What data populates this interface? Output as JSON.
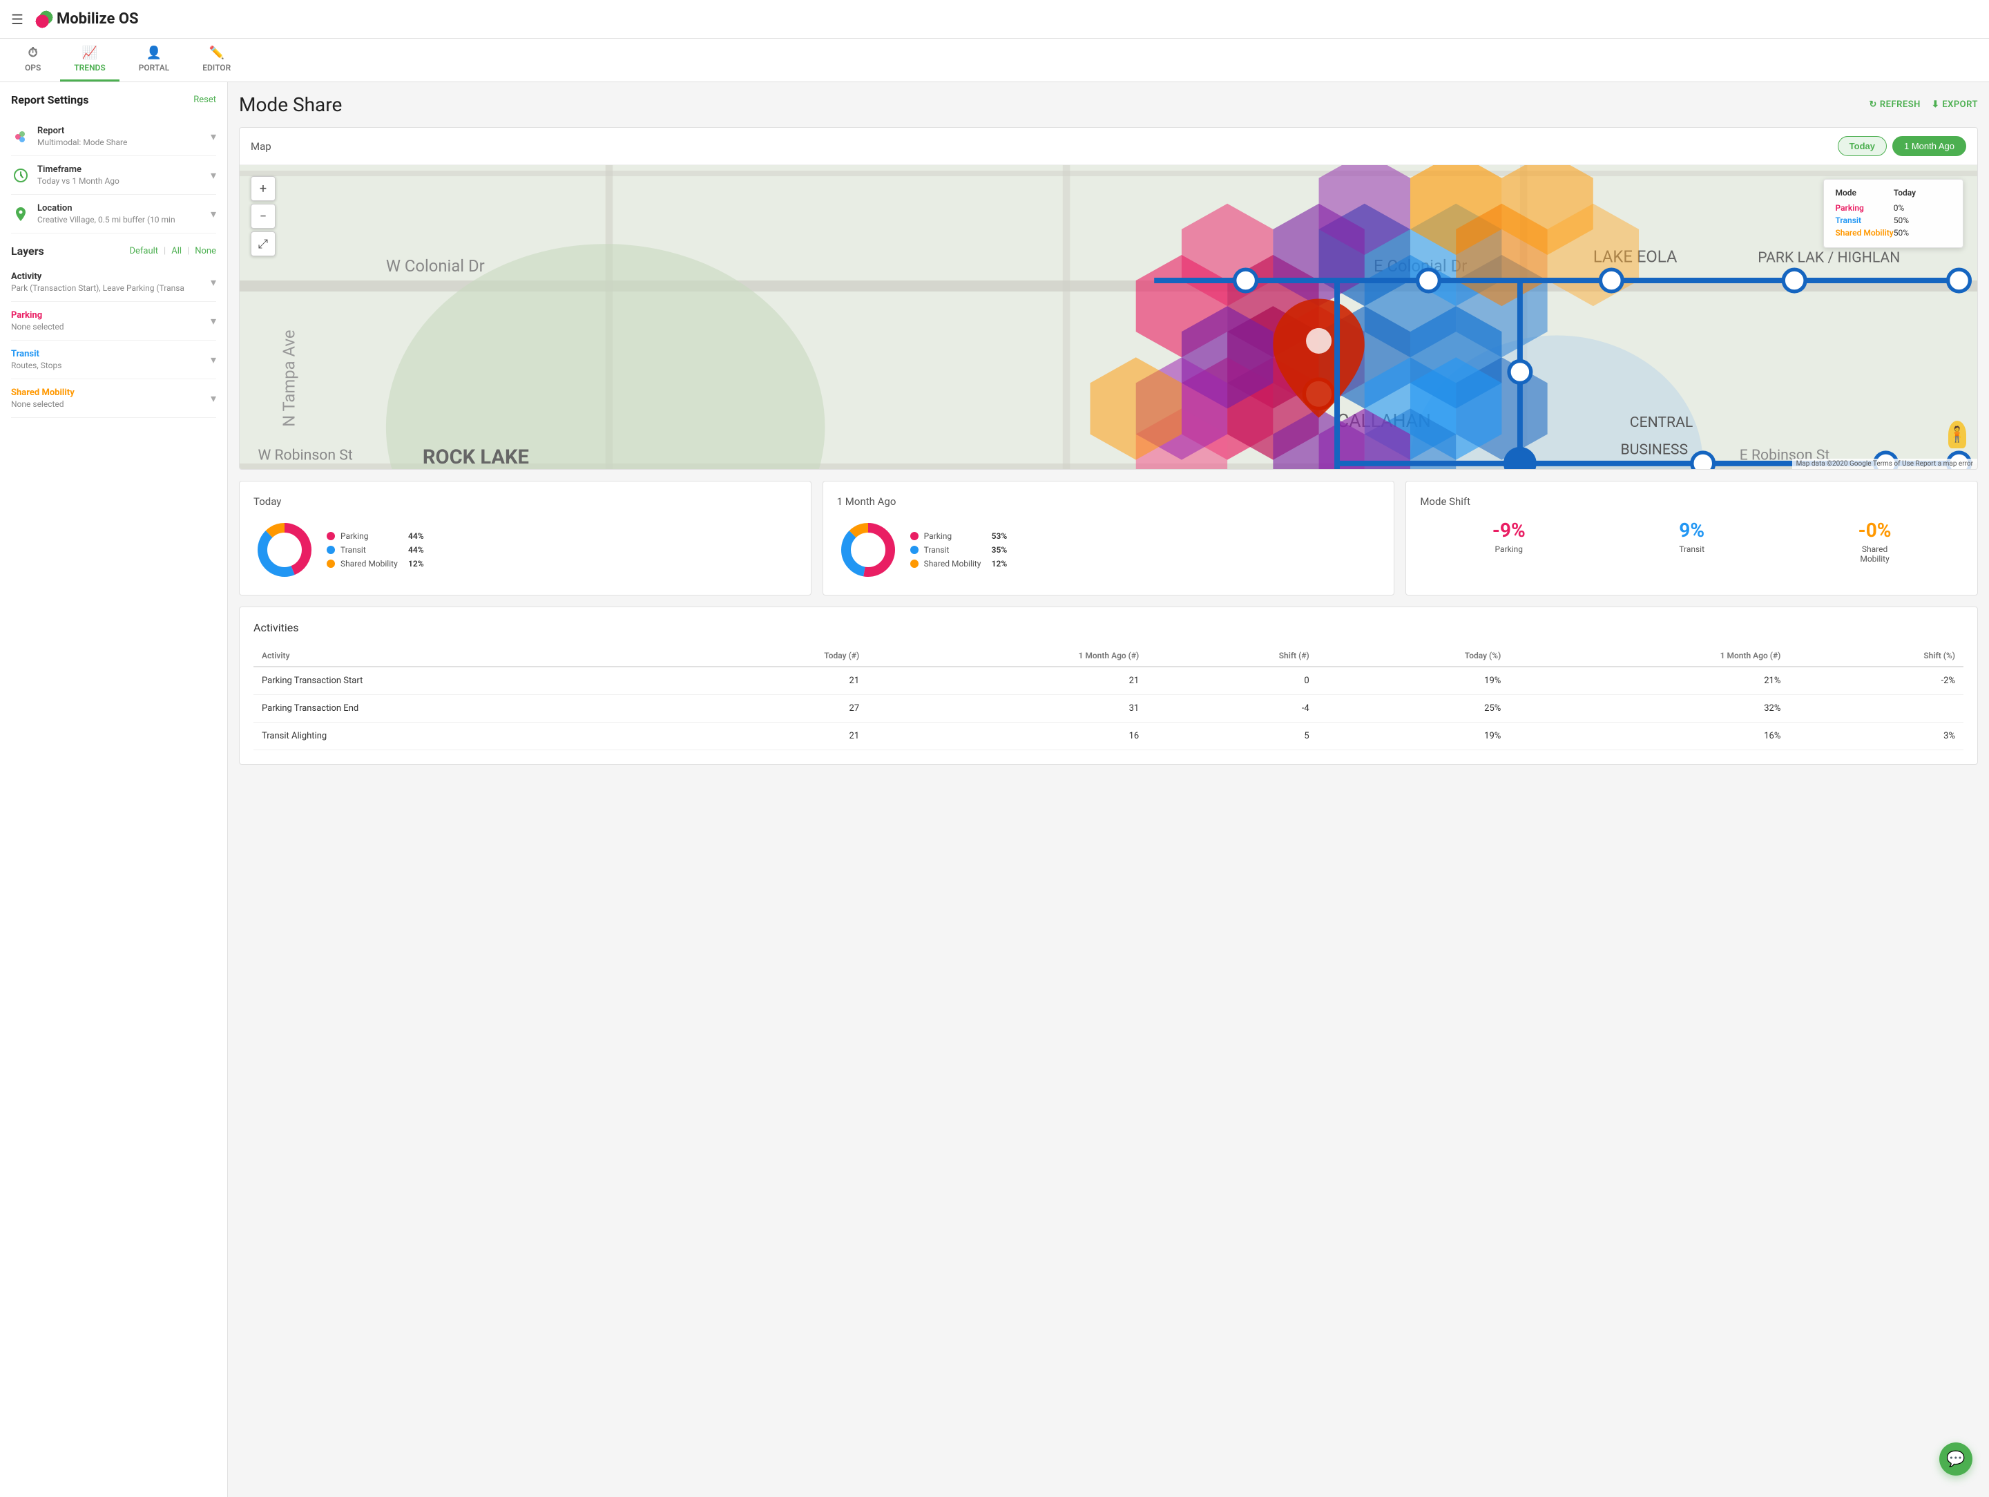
{
  "app": {
    "name": "Mobilize OS",
    "hamburger_label": "☰"
  },
  "tabs": [
    {
      "id": "ops",
      "label": "OPS",
      "icon": "⏱",
      "active": false
    },
    {
      "id": "trends",
      "label": "TRENDS",
      "icon": "↗",
      "active": true
    },
    {
      "id": "portal",
      "label": "PORTAL",
      "icon": "👤",
      "active": false
    },
    {
      "id": "editor",
      "label": "EDITOR",
      "icon": "✏",
      "active": false
    }
  ],
  "page": {
    "title": "Mode Share",
    "refresh_label": "REFRESH",
    "export_label": "EXPORT"
  },
  "sidebar": {
    "report_settings_title": "Report Settings",
    "reset_label": "Reset",
    "report": {
      "label": "Report",
      "value": "Multimodal: Mode Share"
    },
    "timeframe": {
      "label": "Timeframe",
      "value": "Today vs 1 Month Ago"
    },
    "location": {
      "label": "Location",
      "value": "Creative Village, 0.5 mi buffer (10 min"
    },
    "layers_title": "Layers",
    "layers_default": "Default",
    "layers_all": "All",
    "layers_none": "None",
    "activity": {
      "label": "Activity",
      "value": "Park (Transaction Start), Leave Parking (Transa"
    },
    "parking": {
      "label": "Parking",
      "value": "None selected",
      "color": "#e91e63"
    },
    "transit": {
      "label": "Transit",
      "value": "Routes, Stops",
      "color": "#2196f3"
    },
    "shared_mobility": {
      "label": "Shared Mobility",
      "value": "None selected",
      "color": "#ff9800"
    }
  },
  "map": {
    "title": "Map",
    "today_label": "Today",
    "month_ago_label": "1 Month Ago",
    "tooltip": {
      "header_mode": "Mode",
      "header_today": "Today",
      "parking_label": "Parking",
      "parking_value": "0%",
      "transit_label": "Transit",
      "transit_value": "50%",
      "shared_label": "Shared Mobility",
      "shared_value": "50%"
    },
    "attribution": "Map data ©2020 Google  Terms of Use  Report a map error"
  },
  "today_chart": {
    "title": "Today",
    "parking_label": "Parking",
    "parking_value": "44%",
    "parking_color": "#e91e63",
    "transit_label": "Transit",
    "transit_value": "44%",
    "transit_color": "#2196f3",
    "shared_label": "Shared Mobility",
    "shared_value": "12%",
    "shared_color": "#ff9800"
  },
  "month_chart": {
    "title": "1 Month Ago",
    "parking_label": "Parking",
    "parking_value": "53%",
    "parking_color": "#e91e63",
    "transit_label": "Transit",
    "transit_value": "35%",
    "transit_color": "#2196f3",
    "shared_label": "Shared Mobility",
    "shared_value": "12%",
    "shared_color": "#ff9800"
  },
  "mode_shift": {
    "title": "Mode Shift",
    "parking_shift": "-9%",
    "parking_label": "Parking",
    "transit_shift": "9%",
    "transit_label": "Transit",
    "shared_shift": "-0%",
    "shared_label": "Shared\nMobility"
  },
  "activities": {
    "title": "Activities",
    "columns": [
      "Activity",
      "Today (#)",
      "1 Month Ago (#)",
      "Shift (#)",
      "Today (%)",
      "1 Month Ago (#)",
      "Shift (%)"
    ],
    "rows": [
      {
        "activity": "Parking Transaction Start",
        "today_n": "21",
        "month_n": "21",
        "shift_n": "0",
        "today_pct": "19%",
        "month_pct": "21%",
        "shift_pct": "-2%"
      },
      {
        "activity": "Parking Transaction End",
        "today_n": "27",
        "month_n": "31",
        "shift_n": "-4",
        "today_pct": "25%",
        "month_pct": "32%",
        "shift_pct": ""
      },
      {
        "activity": "Transit Alighting",
        "today_n": "21",
        "month_n": "16",
        "shift_n": "5",
        "today_pct": "19%",
        "month_pct": "16%",
        "shift_pct": "3%"
      }
    ]
  }
}
